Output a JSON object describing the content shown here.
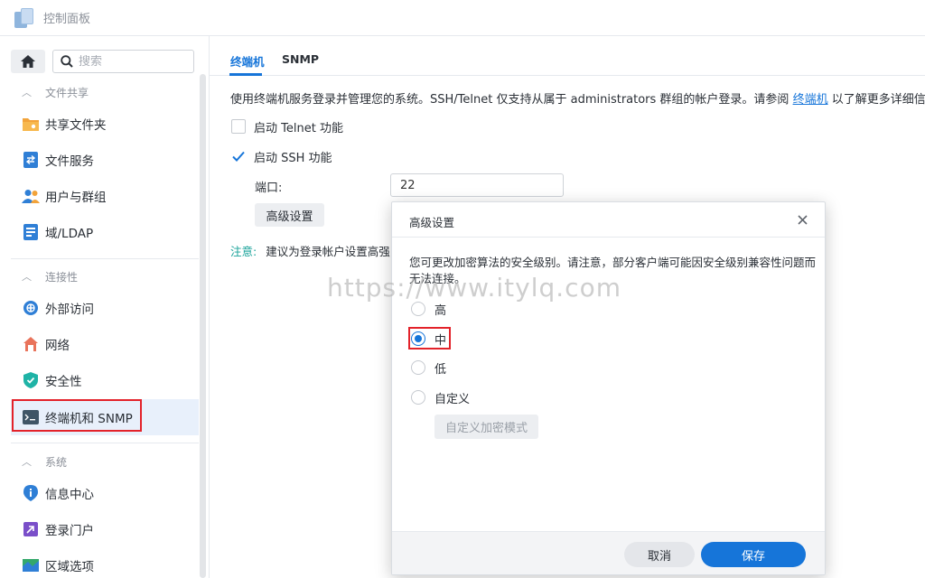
{
  "app": {
    "title": "控制面板"
  },
  "sidebar": {
    "search_placeholder": "搜索",
    "sections": [
      {
        "label": "文件共享",
        "items": [
          "共享文件夹",
          "文件服务",
          "用户与群组",
          "域/LDAP"
        ]
      },
      {
        "label": "连接性",
        "items": [
          "外部访问",
          "网络",
          "安全性",
          "终端机和 SNMP"
        ]
      },
      {
        "label": "系统",
        "items": [
          "信息中心",
          "登录门户",
          "区域选项"
        ]
      }
    ],
    "active_item": "终端机和 SNMP"
  },
  "main": {
    "tabs": [
      "终端机",
      "SNMP"
    ],
    "active_tab": "终端机",
    "description_before": "使用终端机服务登录并管理您的系统。SSH/Telnet 仅支持从属于 administrators 群组的帐户登录。请参阅 ",
    "description_link": "终端机",
    "description_after": " 以了解更多详细信息。",
    "telnet_label": "启动 Telnet 功能",
    "telnet_checked": false,
    "ssh_label": "启动 SSH 功能",
    "ssh_checked": true,
    "port_label": "端口:",
    "port_value": "22",
    "advanced_button": "高级设置",
    "note_label": "注意:",
    "note_text": "建议为登录帐户设置高强"
  },
  "dialog": {
    "title": "高级设置",
    "description": "您可更改加密算法的安全级别。请注意，部分客户端可能因安全级别兼容性问题而无法连接。",
    "options": [
      "高",
      "中",
      "低",
      "自定义"
    ],
    "selected_option": "中",
    "custom_button": "自定义加密模式",
    "cancel_button": "取消",
    "save_button": "保存"
  },
  "watermark": "https://www.itylq.com",
  "colors": {
    "accent": "#1675d9",
    "highlight": "#e3222a",
    "note": "#19a39a"
  }
}
